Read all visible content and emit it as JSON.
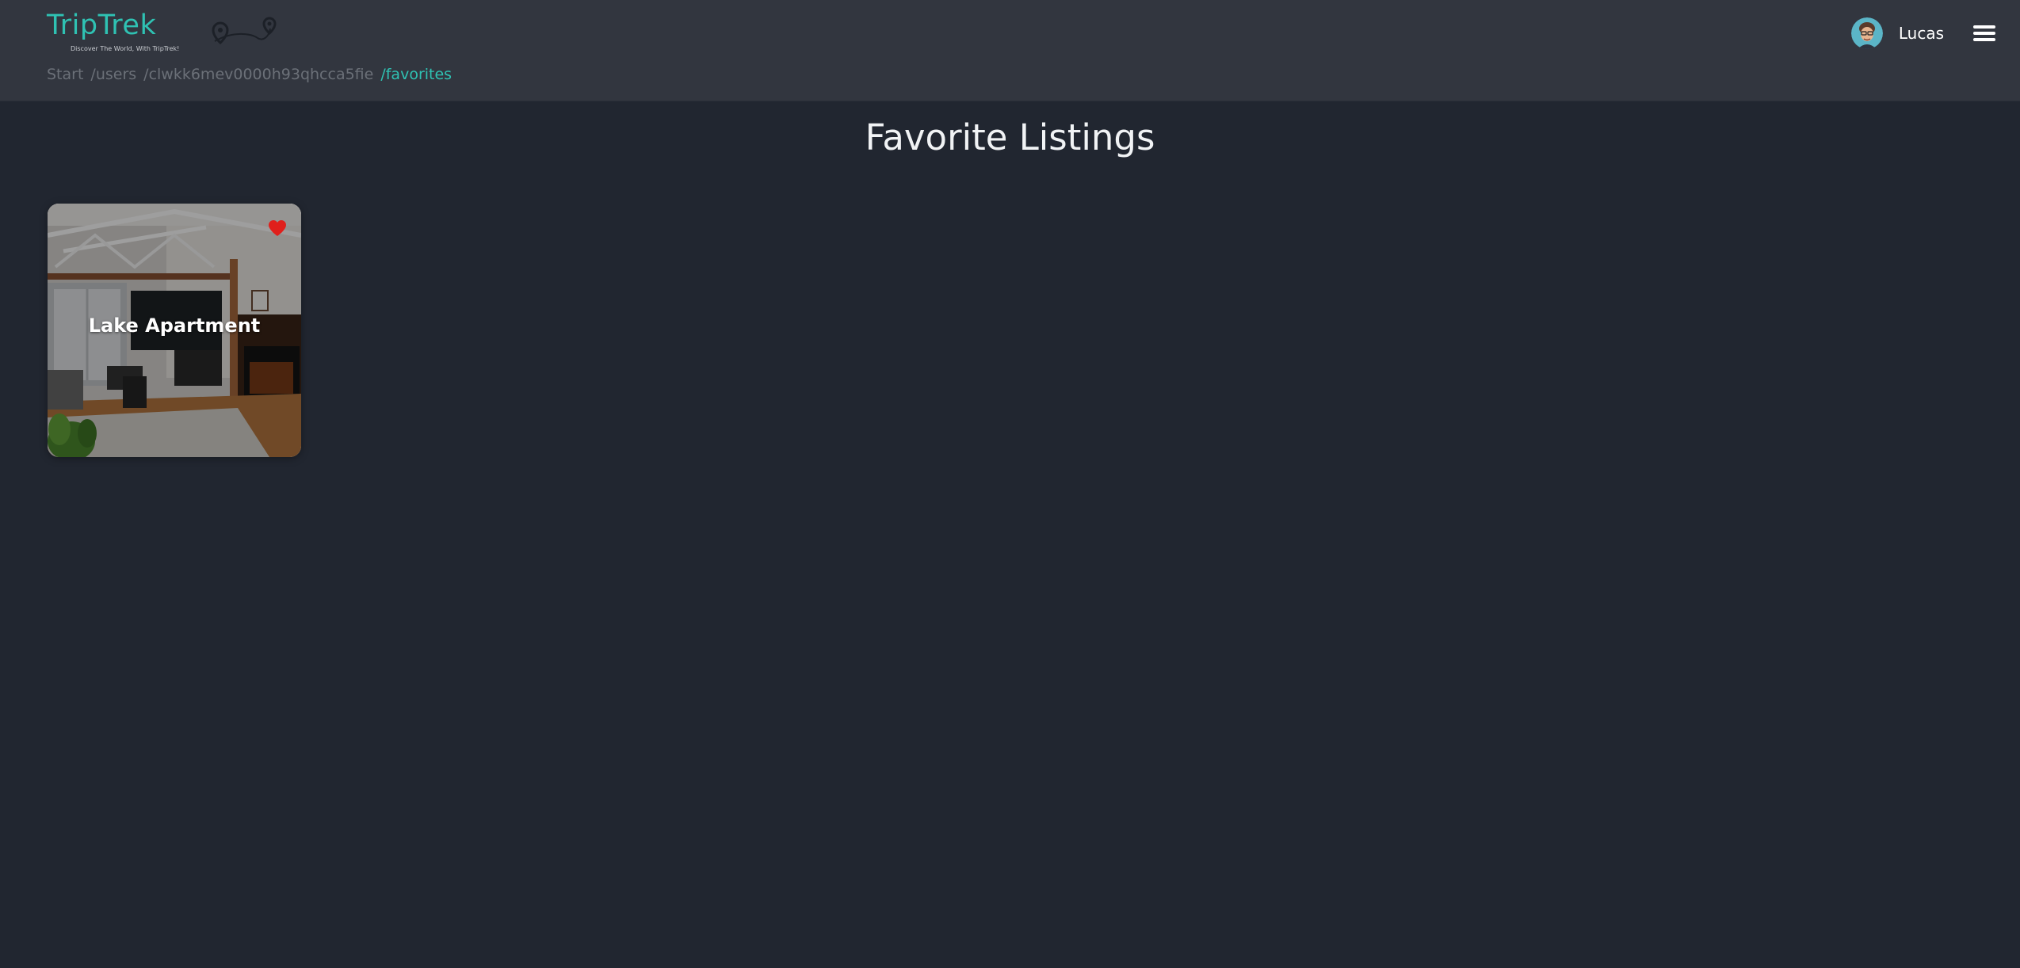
{
  "header": {
    "brand": "TripTrek",
    "tagline": "Discover The World, With TripTrek!",
    "user_name": "Lucas",
    "accent_color": "#2fc2b3"
  },
  "breadcrumb": [
    "Start",
    "/users",
    "/clwkk6mev0000h93qhcca5fie",
    "/favorites"
  ],
  "main": {
    "title": "Favorite Listings",
    "listings": [
      {
        "title": "Lake Apartment",
        "favorited": true,
        "heart_color": "#e0201c"
      }
    ]
  },
  "icons": {
    "menu": "hamburger-menu-icon",
    "favorite": "heart-icon",
    "logo_route": "map-pin-route-icon"
  }
}
